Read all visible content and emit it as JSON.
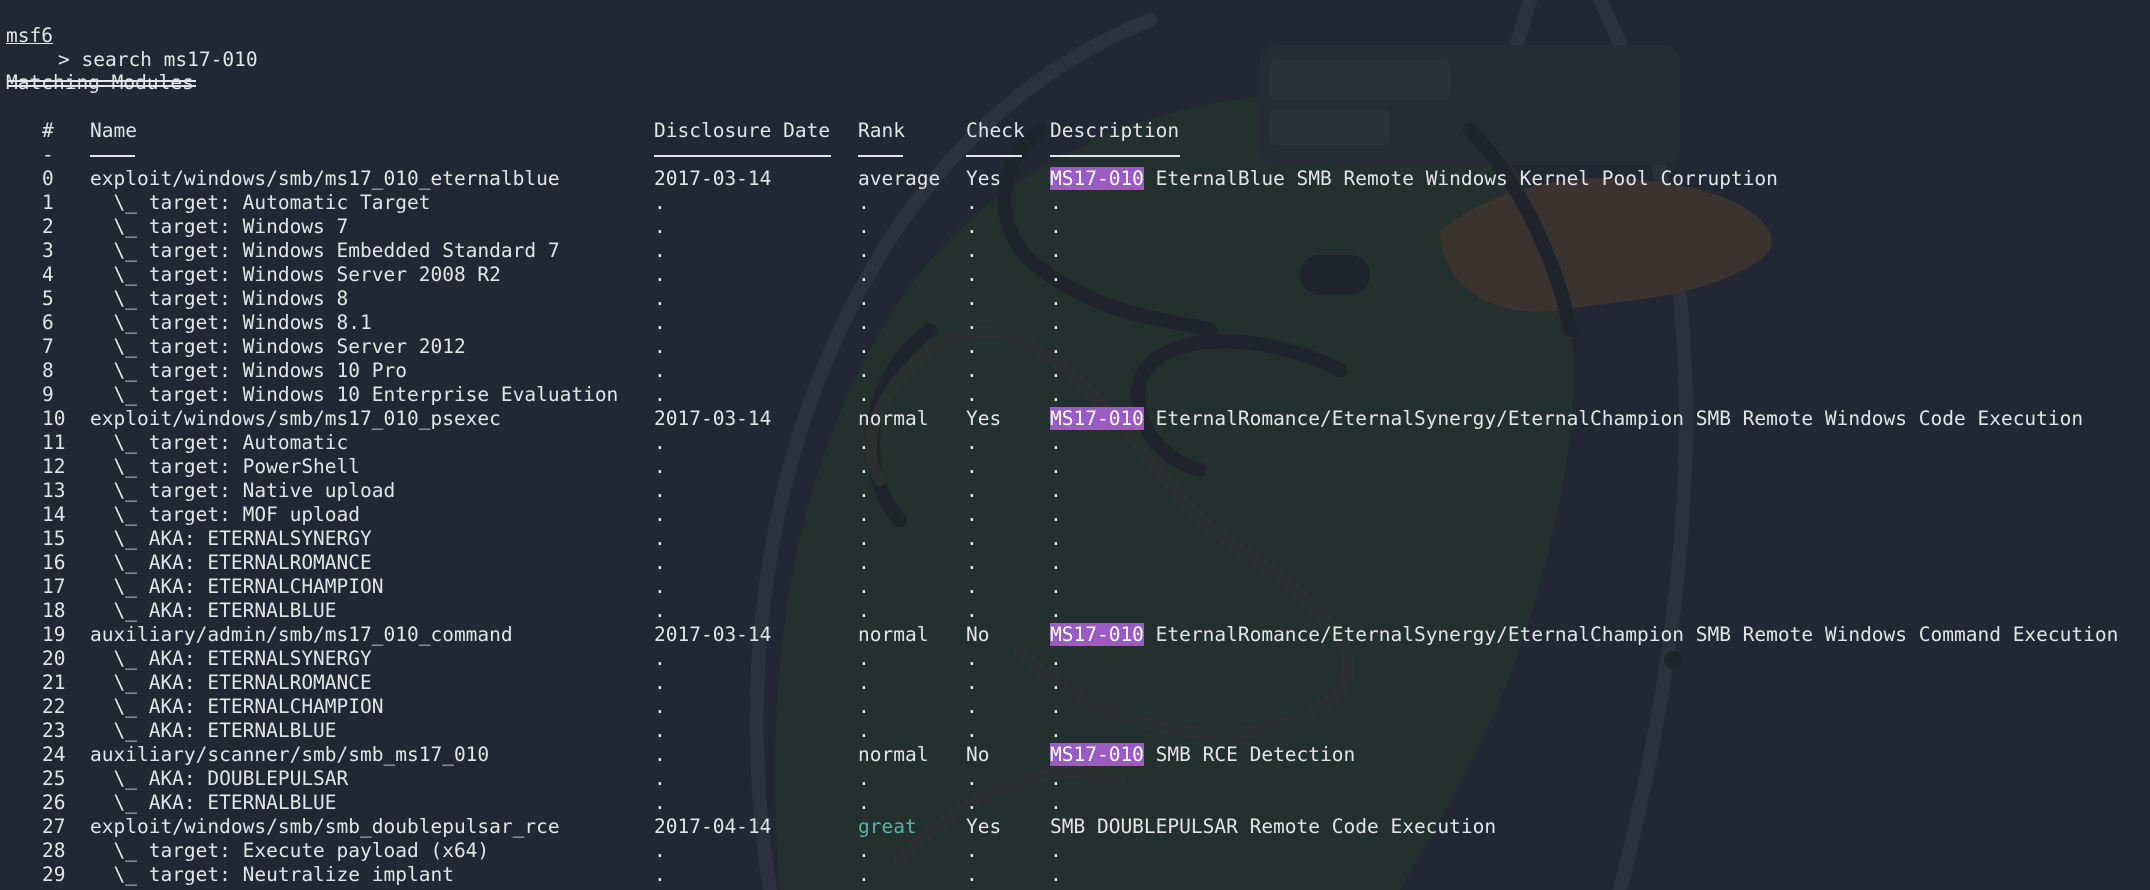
{
  "prompt": {
    "shell": "msf6",
    "command": "> search ms17-010"
  },
  "title": "Matching Modules",
  "columns": {
    "num": "#",
    "name": "Name",
    "date": "Disclosure Date",
    "rank": "Rank",
    "check": "Check",
    "description": "Description"
  },
  "header_dash": "-",
  "colors": {
    "highlight_bg": "#9a5cc4",
    "great_rank": "#57b3a6",
    "background": "#222733",
    "text": "#e2e4e8"
  },
  "rows": [
    {
      "num": "0",
      "name": "exploit/windows/smb/ms17_010_eternalblue",
      "date": "2017-03-14",
      "rank": "average",
      "check": "Yes",
      "tag": "MS17-010",
      "desc": "EternalBlue SMB Remote Windows Kernel Pool Corruption"
    },
    {
      "num": "1",
      "name": "  \\_ target: Automatic Target",
      "date": ".",
      "rank": ".",
      "check": ".",
      "tag": "",
      "desc": "."
    },
    {
      "num": "2",
      "name": "  \\_ target: Windows 7",
      "date": ".",
      "rank": ".",
      "check": ".",
      "tag": "",
      "desc": "."
    },
    {
      "num": "3",
      "name": "  \\_ target: Windows Embedded Standard 7",
      "date": ".",
      "rank": ".",
      "check": ".",
      "tag": "",
      "desc": "."
    },
    {
      "num": "4",
      "name": "  \\_ target: Windows Server 2008 R2",
      "date": ".",
      "rank": ".",
      "check": ".",
      "tag": "",
      "desc": "."
    },
    {
      "num": "5",
      "name": "  \\_ target: Windows 8",
      "date": ".",
      "rank": ".",
      "check": ".",
      "tag": "",
      "desc": "."
    },
    {
      "num": "6",
      "name": "  \\_ target: Windows 8.1",
      "date": ".",
      "rank": ".",
      "check": ".",
      "tag": "",
      "desc": "."
    },
    {
      "num": "7",
      "name": "  \\_ target: Windows Server 2012",
      "date": ".",
      "rank": ".",
      "check": ".",
      "tag": "",
      "desc": "."
    },
    {
      "num": "8",
      "name": "  \\_ target: Windows 10 Pro",
      "date": ".",
      "rank": ".",
      "check": ".",
      "tag": "",
      "desc": "."
    },
    {
      "num": "9",
      "name": "  \\_ target: Windows 10 Enterprise Evaluation",
      "date": ".",
      "rank": ".",
      "check": ".",
      "tag": "",
      "desc": "."
    },
    {
      "num": "10",
      "name": "exploit/windows/smb/ms17_010_psexec",
      "date": "2017-03-14",
      "rank": "normal",
      "check": "Yes",
      "tag": "MS17-010",
      "desc": "EternalRomance/EternalSynergy/EternalChampion SMB Remote Windows Code Execution"
    },
    {
      "num": "11",
      "name": "  \\_ target: Automatic",
      "date": ".",
      "rank": ".",
      "check": ".",
      "tag": "",
      "desc": "."
    },
    {
      "num": "12",
      "name": "  \\_ target: PowerShell",
      "date": ".",
      "rank": ".",
      "check": ".",
      "tag": "",
      "desc": "."
    },
    {
      "num": "13",
      "name": "  \\_ target: Native upload",
      "date": ".",
      "rank": ".",
      "check": ".",
      "tag": "",
      "desc": "."
    },
    {
      "num": "14",
      "name": "  \\_ target: MOF upload",
      "date": ".",
      "rank": ".",
      "check": ".",
      "tag": "",
      "desc": "."
    },
    {
      "num": "15",
      "name": "  \\_ AKA: ETERNALSYNERGY",
      "date": ".",
      "rank": ".",
      "check": ".",
      "tag": "",
      "desc": "."
    },
    {
      "num": "16",
      "name": "  \\_ AKA: ETERNALROMANCE",
      "date": ".",
      "rank": ".",
      "check": ".",
      "tag": "",
      "desc": "."
    },
    {
      "num": "17",
      "name": "  \\_ AKA: ETERNALCHAMPION",
      "date": ".",
      "rank": ".",
      "check": ".",
      "tag": "",
      "desc": "."
    },
    {
      "num": "18",
      "name": "  \\_ AKA: ETERNALBLUE",
      "date": ".",
      "rank": ".",
      "check": ".",
      "tag": "",
      "desc": "."
    },
    {
      "num": "19",
      "name": "auxiliary/admin/smb/ms17_010_command",
      "date": "2017-03-14",
      "rank": "normal",
      "check": "No",
      "tag": "MS17-010",
      "desc": "EternalRomance/EternalSynergy/EternalChampion SMB Remote Windows Command Execution"
    },
    {
      "num": "20",
      "name": "  \\_ AKA: ETERNALSYNERGY",
      "date": ".",
      "rank": ".",
      "check": ".",
      "tag": "",
      "desc": "."
    },
    {
      "num": "21",
      "name": "  \\_ AKA: ETERNALROMANCE",
      "date": ".",
      "rank": ".",
      "check": ".",
      "tag": "",
      "desc": "."
    },
    {
      "num": "22",
      "name": "  \\_ AKA: ETERNALCHAMPION",
      "date": ".",
      "rank": ".",
      "check": ".",
      "tag": "",
      "desc": "."
    },
    {
      "num": "23",
      "name": "  \\_ AKA: ETERNALBLUE",
      "date": ".",
      "rank": ".",
      "check": ".",
      "tag": "",
      "desc": "."
    },
    {
      "num": "24",
      "name": "auxiliary/scanner/smb/smb_ms17_010",
      "date": ".",
      "rank": "normal",
      "check": "No",
      "tag": "MS17-010",
      "desc": "SMB RCE Detection"
    },
    {
      "num": "25",
      "name": "  \\_ AKA: DOUBLEPULSAR",
      "date": ".",
      "rank": ".",
      "check": ".",
      "tag": "",
      "desc": "."
    },
    {
      "num": "26",
      "name": "  \\_ AKA: ETERNALBLUE",
      "date": ".",
      "rank": ".",
      "check": ".",
      "tag": "",
      "desc": "."
    },
    {
      "num": "27",
      "name": "exploit/windows/smb/smb_doublepulsar_rce",
      "date": "2017-04-14",
      "rank": "great",
      "check": "Yes",
      "tag": "",
      "desc": "SMB DOUBLEPULSAR Remote Code Execution"
    },
    {
      "num": "28",
      "name": "  \\_ target: Execute payload (x64)",
      "date": ".",
      "rank": ".",
      "check": ".",
      "tag": "",
      "desc": "."
    },
    {
      "num": "29",
      "name": "  \\_ target: Neutralize implant",
      "date": ".",
      "rank": ".",
      "check": ".",
      "tag": "",
      "desc": "."
    }
  ]
}
